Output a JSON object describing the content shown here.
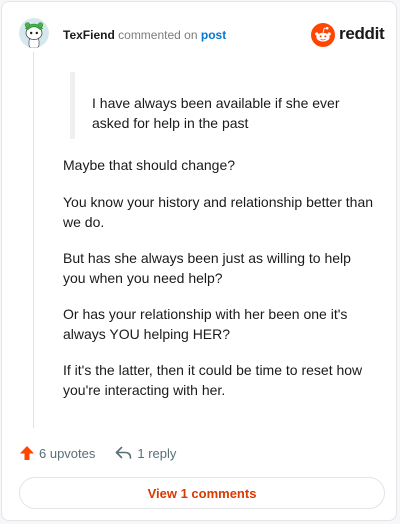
{
  "header": {
    "username": "TexFiend",
    "action_text": "commented on",
    "target_link": "post",
    "avatar_icon": "snoo-avatar-icon",
    "brand_icon": "reddit-logo-icon",
    "brand_name": "reddit"
  },
  "comment": {
    "quote": "I have always been available if she ever asked for help in the past",
    "paragraphs": [
      "Maybe that should change?",
      "You know your history and relationship better than we do.",
      "But has she always been just as willing to help you when you need help?",
      "Or has your relationship with her been one it's always YOU helping HER?",
      "If it's the latter, then it could be time to reset how you're interacting with her."
    ]
  },
  "footer": {
    "upvotes_label": "6 upvotes",
    "upvote_icon": "upvote-arrow-icon",
    "reply_label": "1 reply",
    "reply_icon": "reply-arrow-icon"
  },
  "view_button": {
    "label": "View 1 comments"
  },
  "colors": {
    "accent": "#ff4500",
    "link": "#0079d3",
    "button_text": "#d93a00",
    "avatar_bg": "#d4e8ed",
    "avatar_green": "#46b648"
  }
}
